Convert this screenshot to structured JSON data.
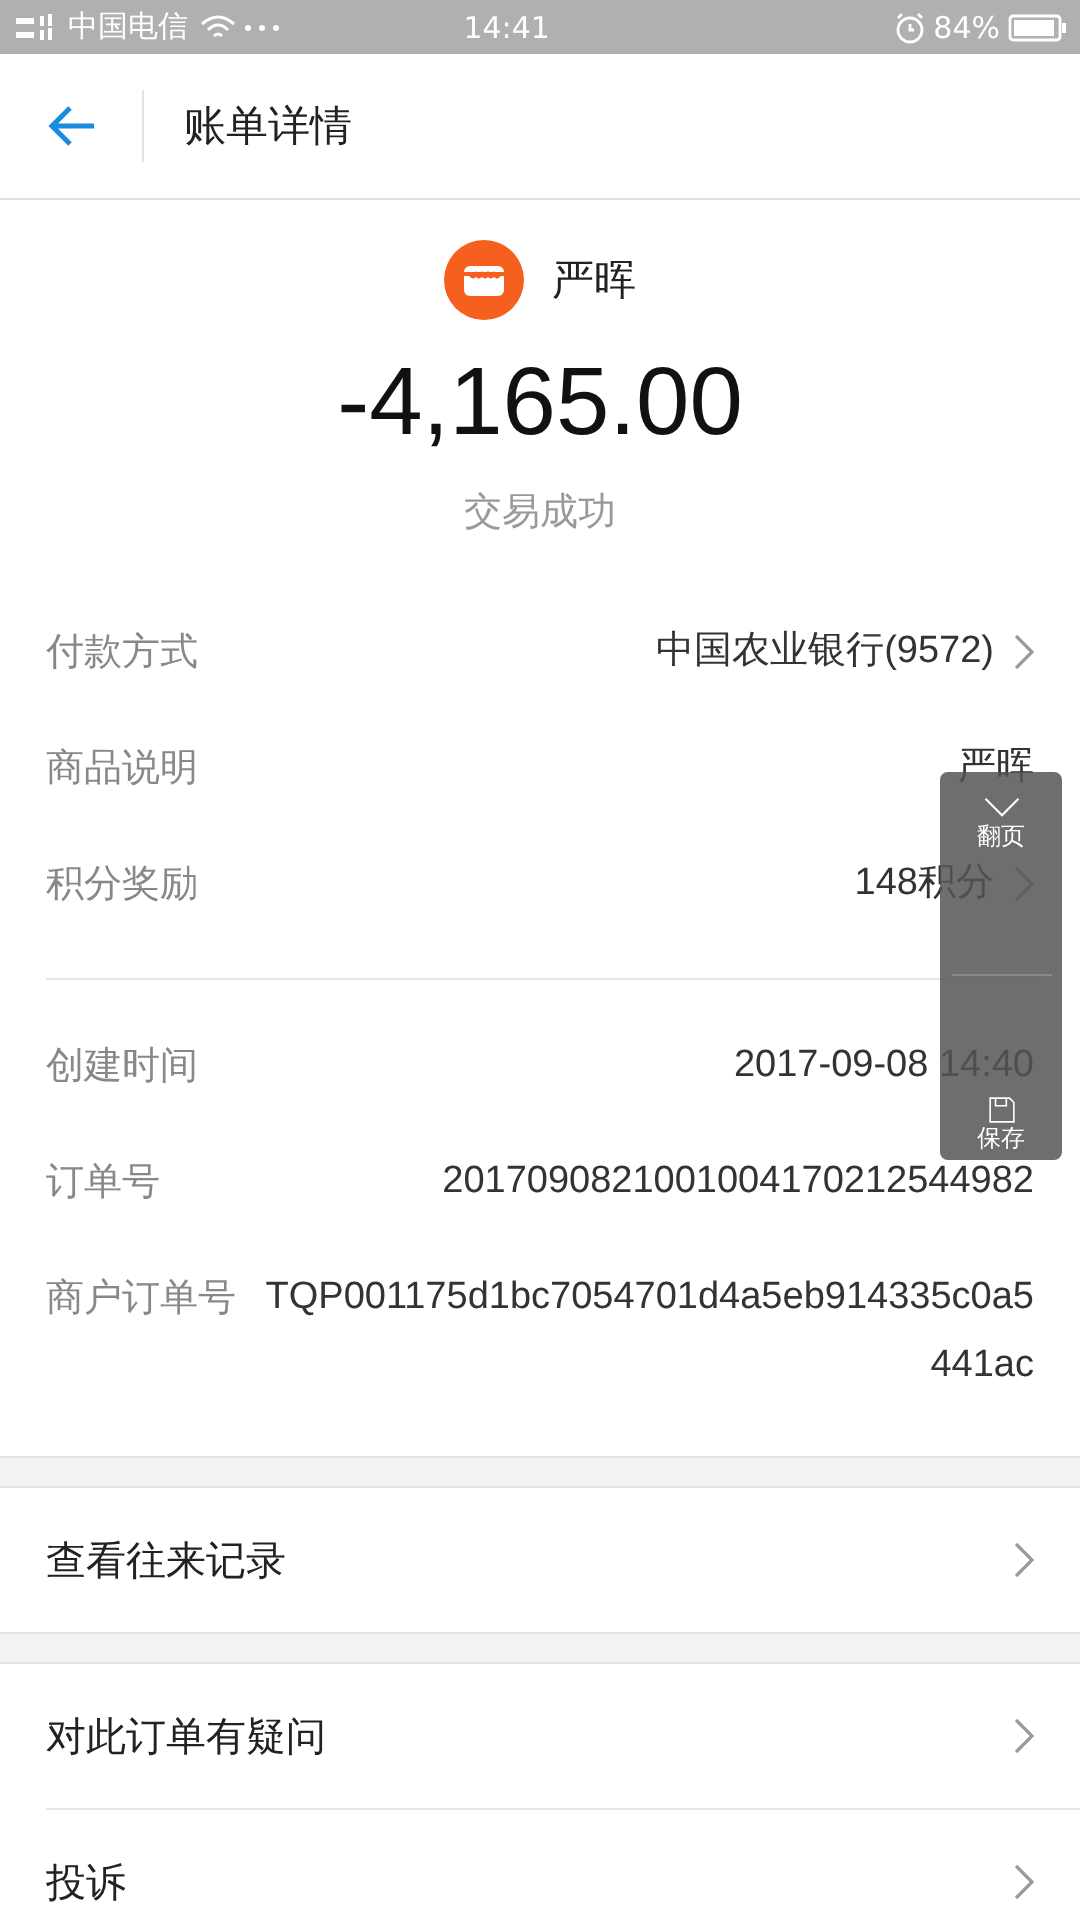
{
  "status_bar": {
    "carrier": "中国电信",
    "time": "14:41",
    "battery": "84%"
  },
  "header": {
    "title": "账单详情"
  },
  "merchant": {
    "name": "严晖"
  },
  "amount": "-4,165.00",
  "trade_status": "交易成功",
  "detail_groups": [
    [
      {
        "label": "付款方式",
        "value": "中国农业银行(9572)",
        "chevron": true
      },
      {
        "label": "商品说明",
        "value": "严晖",
        "chevron": false
      },
      {
        "label": "积分奖励",
        "value": "148积分",
        "chevron": true
      }
    ],
    [
      {
        "label": "创建时间",
        "value": "2017-09-08 14:40",
        "chevron": false
      },
      {
        "label": "订单号",
        "value": "2017090821001004170212544982",
        "chevron": false
      },
      {
        "label": "商户订单号",
        "value": "TQP001175d1bc7054701d4a5eb914335c0a5441ac",
        "chevron": false
      }
    ]
  ],
  "link_groups": [
    [
      {
        "label": "查看往来记录"
      }
    ],
    [
      {
        "label": "对此订单有疑问"
      },
      {
        "label": "投诉"
      }
    ]
  ],
  "float_panel": {
    "page_label": "翻页",
    "save_label": "保存"
  }
}
